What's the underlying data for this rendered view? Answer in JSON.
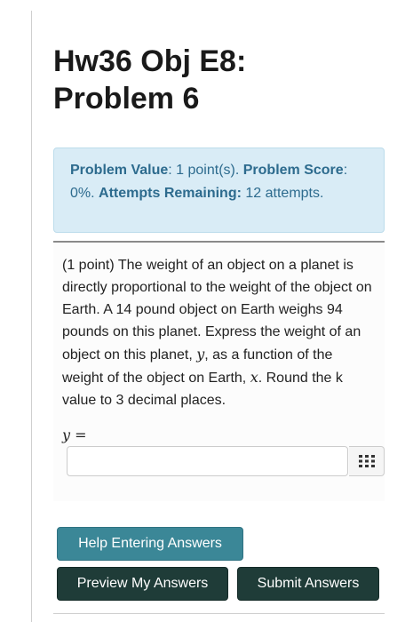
{
  "header": {
    "title_line1": "Hw36 Obj E8:",
    "title_line2": "Problem 6"
  },
  "problem_info": {
    "value_label": "Problem Value",
    "value_text": ": 1 point(s).",
    "score_label": "Problem Score",
    "score_text": ": 0%.",
    "attempts_label": "Attempts Remaining:",
    "attempts_text": " 12 attempts."
  },
  "problem": {
    "text_part1": "(1 point) The weight of an object on a planet is directly proportional to the weight of the object on Earth. A 14 pound object on Earth weighs 94 pounds on this planet. Express the weight of an object on this planet, ",
    "var_y": "y",
    "text_part2": ", as a function of the weight of the object on Earth, ",
    "var_x": "x",
    "text_part3": ". Round the k value to 3 decimal places.",
    "answer_var": "y",
    "answer_eq": " =",
    "answer_value": "",
    "answer_placeholder": ""
  },
  "icons": {
    "keypad": "keypad-grid-icon"
  },
  "buttons": {
    "help_label": "Help Entering Answers",
    "preview_label": "Preview My Answers",
    "submit_label": "Submit Answers"
  },
  "colors": {
    "info_bg": "#d9ecf6",
    "info_text": "#2d6b8e",
    "help_button": "#3b8797",
    "dark_button": "#1f3c38"
  }
}
